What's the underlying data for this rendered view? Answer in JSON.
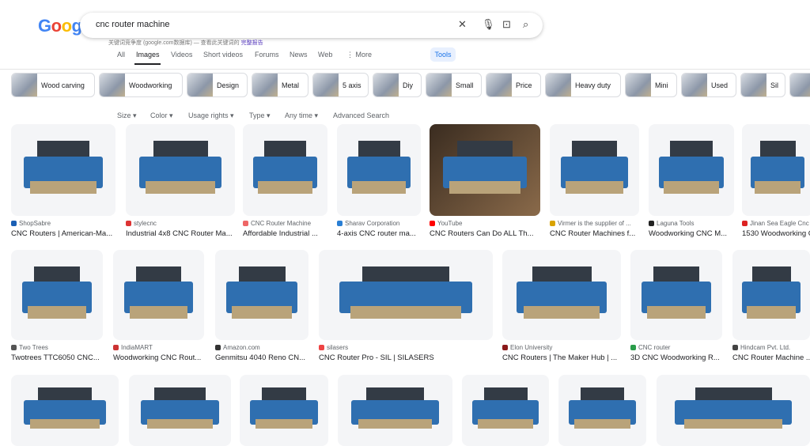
{
  "header": {
    "logo": "Google",
    "query": "cnc router machine",
    "notice": "关键词竞争度 (google.com数据库) — 查看此关键词的",
    "notice_link": "完整报告",
    "tabs": [
      "All",
      "Images",
      "Videos",
      "Short videos",
      "Forums",
      "News",
      "Web",
      "⋮ More"
    ],
    "active_tab": "Images",
    "tools": "Tools"
  },
  "chips": [
    "Wood carving",
    "Woodworking",
    "Design",
    "Metal",
    "5 axis",
    "Diy",
    "Small",
    "Price",
    "Heavy duty",
    "Mini",
    "Used",
    "Sil",
    ""
  ],
  "filters": [
    "Size ▾",
    "Color ▾",
    "Usage rights ▾",
    "Type ▾",
    "Any time ▾",
    "Advanced Search"
  ],
  "rows": [
    [
      {
        "source": "ShopSabre",
        "title": "CNC Routers | American-Ma...",
        "color": "#1a5fb4"
      },
      {
        "source": "stylecnc",
        "title": "Industrial 4x8 CNC Router Ma...",
        "color": "#d33"
      },
      {
        "source": "CNC Router Machine",
        "title": "Affordable Industrial ...",
        "color": "#e66"
      },
      {
        "source": "Sharav Corporation",
        "title": "4-axis CNC router ma...",
        "color": "#2a7fd4"
      },
      {
        "source": "YouTube",
        "title": "CNC Routers Can Do ALL Th...",
        "color": "#f00"
      },
      {
        "source": "Virmer is the supplier of ...",
        "title": "CNC Router Machines f...",
        "color": "#d9a300"
      },
      {
        "source": "Laguna Tools",
        "title": "Woodworking CNC M...",
        "color": "#222"
      },
      {
        "source": "Jinan Sea Eagle Cnc",
        "title": "1530 Woodworking CNC",
        "color": "#d22"
      }
    ],
    [
      {
        "source": "Two Trees",
        "title": "Twotrees TTC6050 CNC...",
        "color": "#555"
      },
      {
        "source": "IndiaMART",
        "title": "Woodworking CNC Rout...",
        "color": "#c33"
      },
      {
        "source": "Amazon.com",
        "title": "Genmitsu 4040 Reno CN...",
        "color": "#333"
      },
      {
        "source": "silasers",
        "title": "CNC Router Pro - SIL | SILASERS",
        "color": "#e44"
      },
      {
        "source": "Elon University",
        "title": "CNC Routers | The Maker Hub | ...",
        "color": "#8b1a1a"
      },
      {
        "source": "CNC router",
        "title": "3D CNC Woodworking R...",
        "color": "#2a9d4a"
      },
      {
        "source": "Hindcam Pvt. Ltd.",
        "title": "CNC Router Machine ...",
        "color": "#444"
      }
    ],
    [
      {},
      {},
      {},
      {},
      {},
      {},
      {}
    ]
  ]
}
